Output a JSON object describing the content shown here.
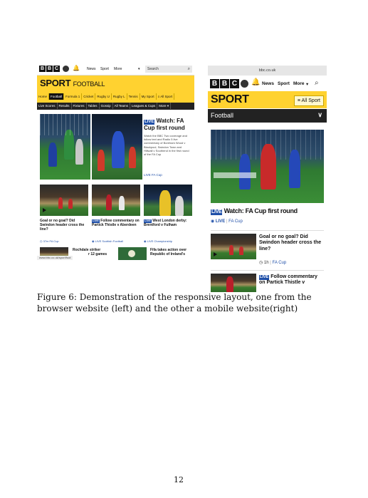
{
  "desktop": {
    "bbc_letters": [
      "B",
      "B",
      "C"
    ],
    "nav": [
      "News",
      "Sport",
      "More"
    ],
    "more_caret": "▾",
    "search_placeholder": "Search",
    "sport_title": "SPORT",
    "sport_sub": "FOOTBALL",
    "tabs": [
      "Home",
      "Football",
      "Formula 1",
      "Cricket",
      "Rugby U",
      "Rugby L",
      "Tennis",
      "My Sport",
      "All Sport"
    ],
    "subtabs": [
      "Live Scores",
      "Results",
      "Fixtures",
      "Tables",
      "Gossip",
      "All Teams",
      "Leagues & Cups",
      "More"
    ],
    "live_badge": "LIVE",
    "main_headline_a": "Watch: FA",
    "main_headline_b": "Cup first round",
    "main_desc": "Watch the BBC Two coverage and follow text and Radio 5 live commentary of Boreham Wood v Blackpool, Swindon Town and Hillwall v Southend in the first round of the FA Cup",
    "main_meta": "LIVE  FA Cup",
    "card1_headline": "Goal or no goal? Did Swindon header cross the line?",
    "card1_meta": "37m  FA Cup",
    "card2_headline": "Follow commentary on Partick Thistle v Aberdeen",
    "card2_meta": "LIVE  Scottish Football",
    "card3_headline": "West London derby: Brentford v Fulham",
    "card3_meta": "LIVE  Championship",
    "bottom1": "Rochdale striker",
    "bottom1b": "r 12 games",
    "bottom2": "Fifa takes action over",
    "bottom2b": "Republic of Ireland's",
    "status_url": "www.bbc.co.uk/sport/foot"
  },
  "mobile": {
    "url": "bbc.co.uk",
    "bbc_letters": [
      "B",
      "B",
      "C"
    ],
    "nav": [
      "News",
      "Sport",
      "More"
    ],
    "more_caret": "▾",
    "sport_title": "SPORT",
    "all_sport": "All Sport",
    "section": "Football",
    "section_caret": "∨",
    "live_badge": "LIVE",
    "main_headline": "Watch: FA Cup first round",
    "main_meta_live": "LIVE",
    "main_meta_tag": "FA Cup",
    "card1_headline": "Goal or no goal? Did Swindon header cross the line?",
    "card1_time": "1h",
    "card1_tag": "FA Cup",
    "card2_headline": "Follow commentary on Partick Thistle v"
  },
  "caption": "Figure 6: Demonstration of the responsive layout, one from the browser website (left) and the other a mobile website(right)",
  "page_number": "12",
  "colors": {
    "bbc_yellow": "#ffd230",
    "live_blue": "#1f4fa8",
    "dark_bar": "#222222"
  }
}
